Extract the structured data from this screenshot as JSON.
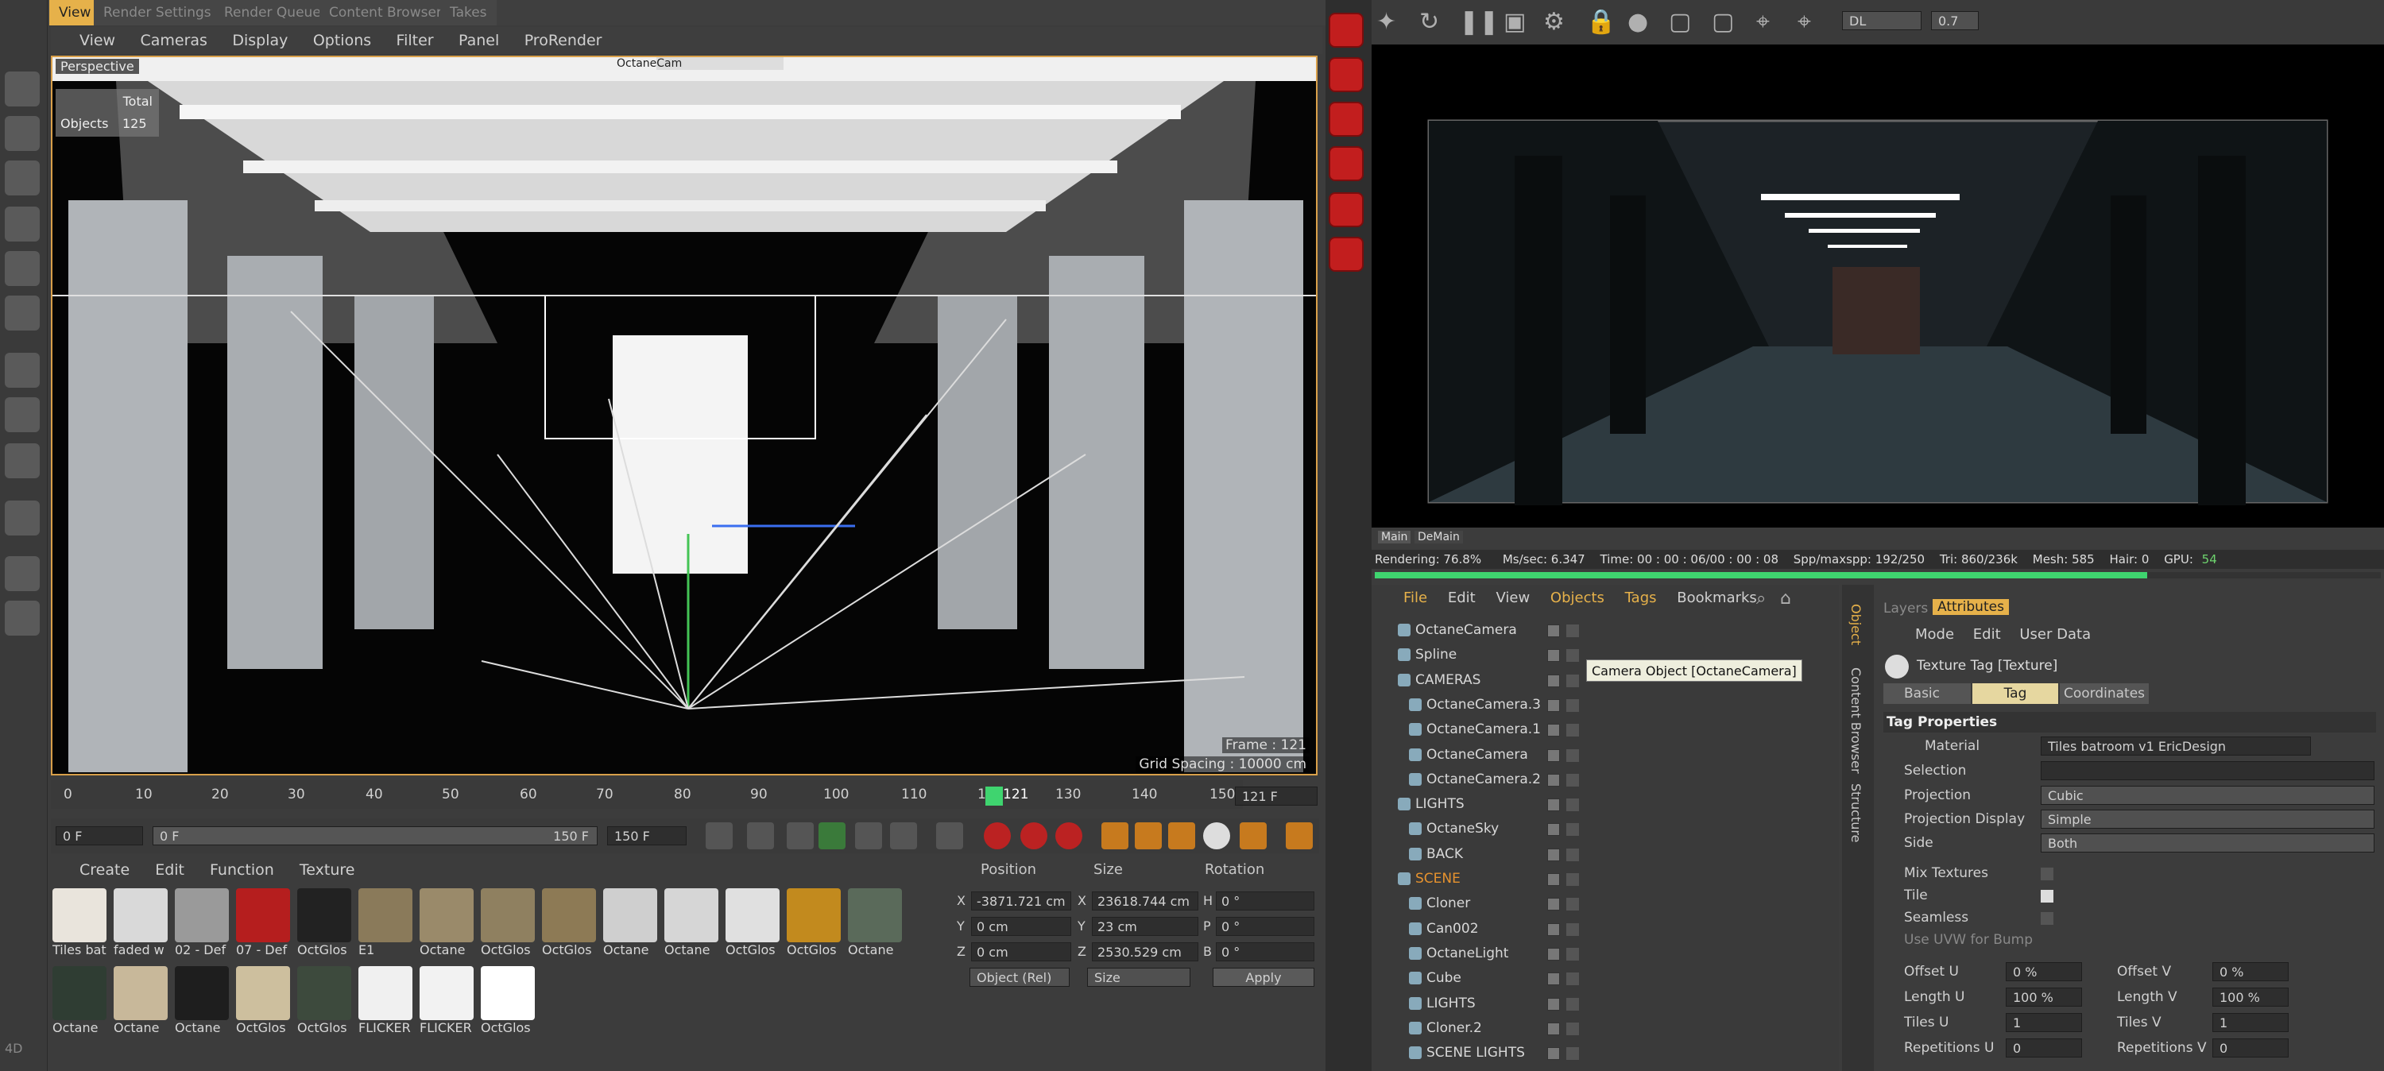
{
  "top_tabs": [
    "View",
    "Render Settings",
    "Render Queue",
    "Content Browser",
    "Takes"
  ],
  "viewport": {
    "menu": [
      "View",
      "Cameras",
      "Display",
      "Options",
      "Filter",
      "Panel",
      "ProRender"
    ],
    "label": "Perspective",
    "stats_total": "Total",
    "stats_objects_label": "Objects",
    "stats_objects_value": "125",
    "frame": "Frame : 121",
    "grid_spacing": "Grid Spacing : 10000 cm",
    "camera_label": "OctaneCam"
  },
  "render_toolbar": {
    "mode": "DL",
    "zoom": "0.7",
    "tabs": [
      "Main",
      "DeMain"
    ],
    "status": {
      "rendering": "Rendering: 76.8%",
      "ms": "Ms/sec: 6.347",
      "time": "Time: 00 : 00 : 06/00 : 00 : 08",
      "spp": "Spp/maxspp: 192/250",
      "tri": "Tri: 860/236k",
      "mesh": "Mesh: 585",
      "hair": "Hair: 0",
      "gpu": "GPU:",
      "gpu_val": "54"
    },
    "progress": 0.768
  },
  "timeline": {
    "ticks": [
      "0",
      "10",
      "20",
      "30",
      "40",
      "50",
      "60",
      "70",
      "80",
      "90",
      "100",
      "110",
      "120",
      "130",
      "140",
      "150"
    ],
    "current": "121",
    "current_field": "121 F",
    "start": "0 F",
    "min": "0 F",
    "max_inner": "150 F",
    "max": "150 F"
  },
  "materials": {
    "menu": [
      "Create",
      "Edit",
      "Function",
      "Texture"
    ],
    "row1": [
      "Tiles bat",
      "faded w",
      "02 - Def",
      "07 - Def",
      "OctGlos",
      "E1",
      "Octane",
      "OctGlos",
      "OctGlos",
      "Octane",
      "Octane",
      "OctGlos",
      "OctGlos",
      "Octane"
    ],
    "row2": [
      "Octane",
      "Octane",
      "Octane",
      "OctGlos",
      "OctGlos",
      "FLICKER",
      "FLICKER",
      "OctGlos"
    ],
    "colors": [
      "#e9e4dc",
      "#d9d9d9",
      "#9a9a9a",
      "#b51e1e",
      "#222222",
      "#8a7a5a",
      "#9a8a6a",
      "#8f8060",
      "#8d7a55",
      "#cfcfcf",
      "#d6d6d6",
      "#e0e0e0",
      "#c28a1e",
      "#5a6a5a",
      "#2f3d33",
      "#c8b89a",
      "#1e1e1e",
      "#cdbf9e",
      "#3d4a3d",
      "#f0f0f0",
      "#f2f2f2",
      "#ffffff"
    ]
  },
  "coords": {
    "headers": [
      "Position",
      "Size",
      "Rotation"
    ],
    "rows": [
      {
        "axis": "X",
        "pos": "-3871.721 cm",
        "saxis": "X",
        "size": "23618.744 cm",
        "raxis": "H",
        "rot": "0 °"
      },
      {
        "axis": "Y",
        "pos": "0 cm",
        "saxis": "Y",
        "size": "23 cm",
        "raxis": "P",
        "rot": "0 °"
      },
      {
        "axis": "Z",
        "pos": "0 cm",
        "saxis": "Z",
        "size": "2530.529 cm",
        "raxis": "B",
        "rot": "0 °"
      }
    ],
    "mode": "Object (Rel)",
    "size_mode": "Size",
    "apply": "Apply"
  },
  "objects": {
    "menu": [
      "File",
      "Edit",
      "View",
      "Objects",
      "Tags",
      "Bookmarks"
    ],
    "items": [
      {
        "name": "OctaneCamera",
        "indent": 0
      },
      {
        "name": "Spline",
        "indent": 0
      },
      {
        "name": "CAMERAS",
        "indent": 0
      },
      {
        "name": "OctaneCamera.3",
        "indent": 1
      },
      {
        "name": "OctaneCamera.1",
        "indent": 1
      },
      {
        "name": "OctaneCamera",
        "indent": 1
      },
      {
        "name": "OctaneCamera.2",
        "indent": 1
      },
      {
        "name": "LIGHTS",
        "indent": 0
      },
      {
        "name": "OctaneSky",
        "indent": 1
      },
      {
        "name": "BACK",
        "indent": 1
      },
      {
        "name": "SCENE",
        "indent": 0
      },
      {
        "name": "Cloner",
        "indent": 1
      },
      {
        "name": "Can002",
        "indent": 1
      },
      {
        "name": "OctaneLight",
        "indent": 1
      },
      {
        "name": "Cube",
        "indent": 1
      },
      {
        "name": "LIGHTS",
        "indent": 1
      },
      {
        "name": "Cloner.2",
        "indent": 1
      },
      {
        "name": "SCENE LIGHTS",
        "indent": 1
      }
    ],
    "tooltip": "Camera Object [OctaneCamera]",
    "side_tabs": [
      "Object",
      "Content Browser",
      "Structure"
    ]
  },
  "attributes": {
    "tabs": [
      "Layers",
      "Attributes"
    ],
    "menu": [
      "Mode",
      "Edit",
      "User Data"
    ],
    "title": "Texture Tag [Texture]",
    "subtabs": [
      "Basic",
      "Tag",
      "Coordinates"
    ],
    "section": "Tag Properties",
    "material_label": "Material",
    "material_value": "Tiles batroom v1 EricDesign",
    "selection_label": "Selection",
    "projection_label": "Projection",
    "projection_value": "Cubic",
    "projection_display_label": "Projection Display",
    "projection_display_value": "Simple",
    "side_label": "Side",
    "side_value": "Both",
    "mix_label": "Mix Textures",
    "tile_label": "Tile",
    "seamless_label": "Seamless",
    "uvw_label": "Use UVW for Bump",
    "offset_u_label": "Offset U",
    "offset_u": "0 %",
    "offset_v_label": "Offset V",
    "offset_v": "0 %",
    "length_u_label": "Length U",
    "length_u": "100 %",
    "length_v_label": "Length V",
    "length_v": "100 %",
    "tiles_u_label": "Tiles U",
    "tiles_u": "1",
    "tiles_v_label": "Tiles V",
    "tiles_v": "1",
    "rep_u_label": "Repetitions U",
    "rep_u": "0",
    "rep_v_label": "Repetitions V",
    "rep_v": "0"
  },
  "corner_label": "4D"
}
